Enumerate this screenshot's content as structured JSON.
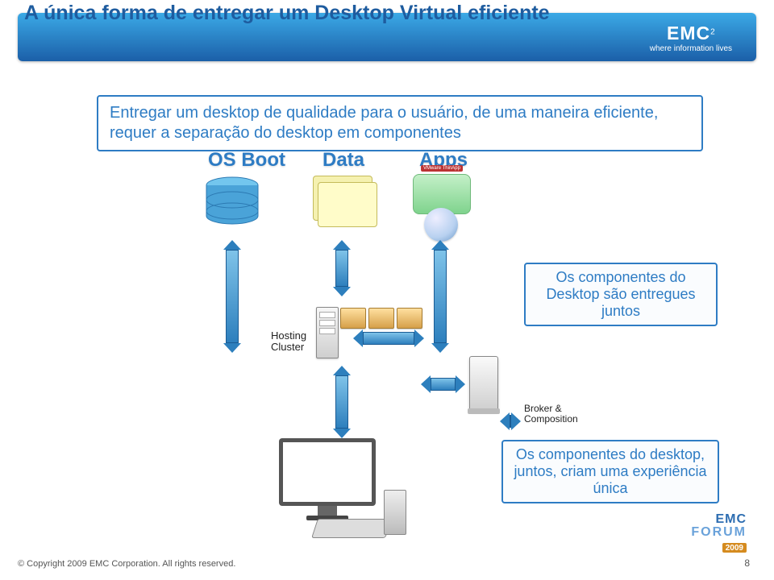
{
  "header": {
    "title": "A única forma de entregar um Desktop Virtual eficiente",
    "logo_main": "EMC",
    "logo_sup": "2",
    "logo_tagline": "where information lives"
  },
  "heading_box": "Entregar um desktop de qualidade para o usuário, de uma maneira eficiente, requer a separação do desktop em componentes",
  "columns": {
    "os": "OS Boot",
    "data": "Data",
    "apps": "Apps"
  },
  "apps_tag": "VMware ThinApp",
  "hosting_label_l1": "Hosting",
  "hosting_label_l2": "Cluster",
  "broker_label_l1": "Broker &",
  "broker_label_l2": "Composition",
  "callouts": {
    "c1": "Os componentes do Desktop são entregues juntos",
    "c2": "Os componentes do desktop, juntos, criam uma experiência única"
  },
  "footer": {
    "copyright": "© Copyright 2009 EMC Corporation. All rights reserved.",
    "page": "8",
    "forum_brand": "EMC",
    "forum_word": "FORUM",
    "forum_year": "2009"
  }
}
